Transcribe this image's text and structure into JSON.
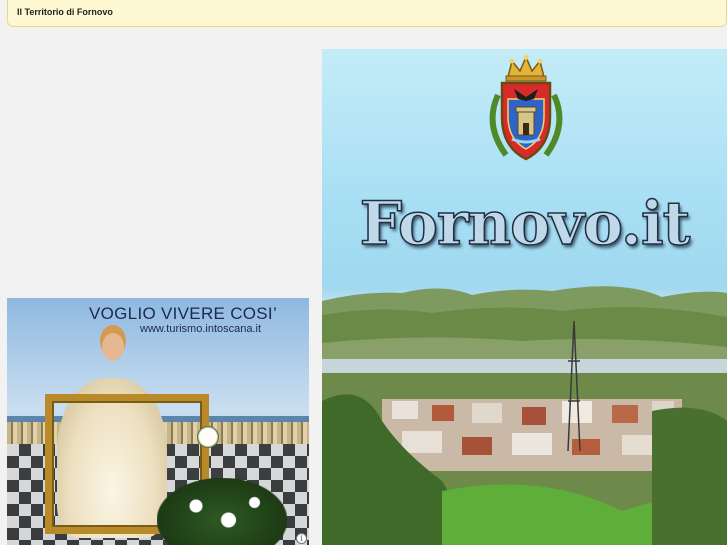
{
  "header": {
    "title": "Il Territorio di Fornovo"
  },
  "advert": {
    "headline": "VOGLIO VIVERE COSI’",
    "url": "www.turismo.intoscana.it",
    "info_symbol": "i"
  },
  "hero": {
    "brand": "Fornovo.it",
    "crest_icon": "coat-of-arms-icon"
  },
  "colors": {
    "topbar_bg": "#fdf8d2",
    "topbar_border": "#e7d88c",
    "page_bg": "#f2f2f2",
    "sky": "#a9dff4",
    "brand_text": "#bfd8ea"
  }
}
